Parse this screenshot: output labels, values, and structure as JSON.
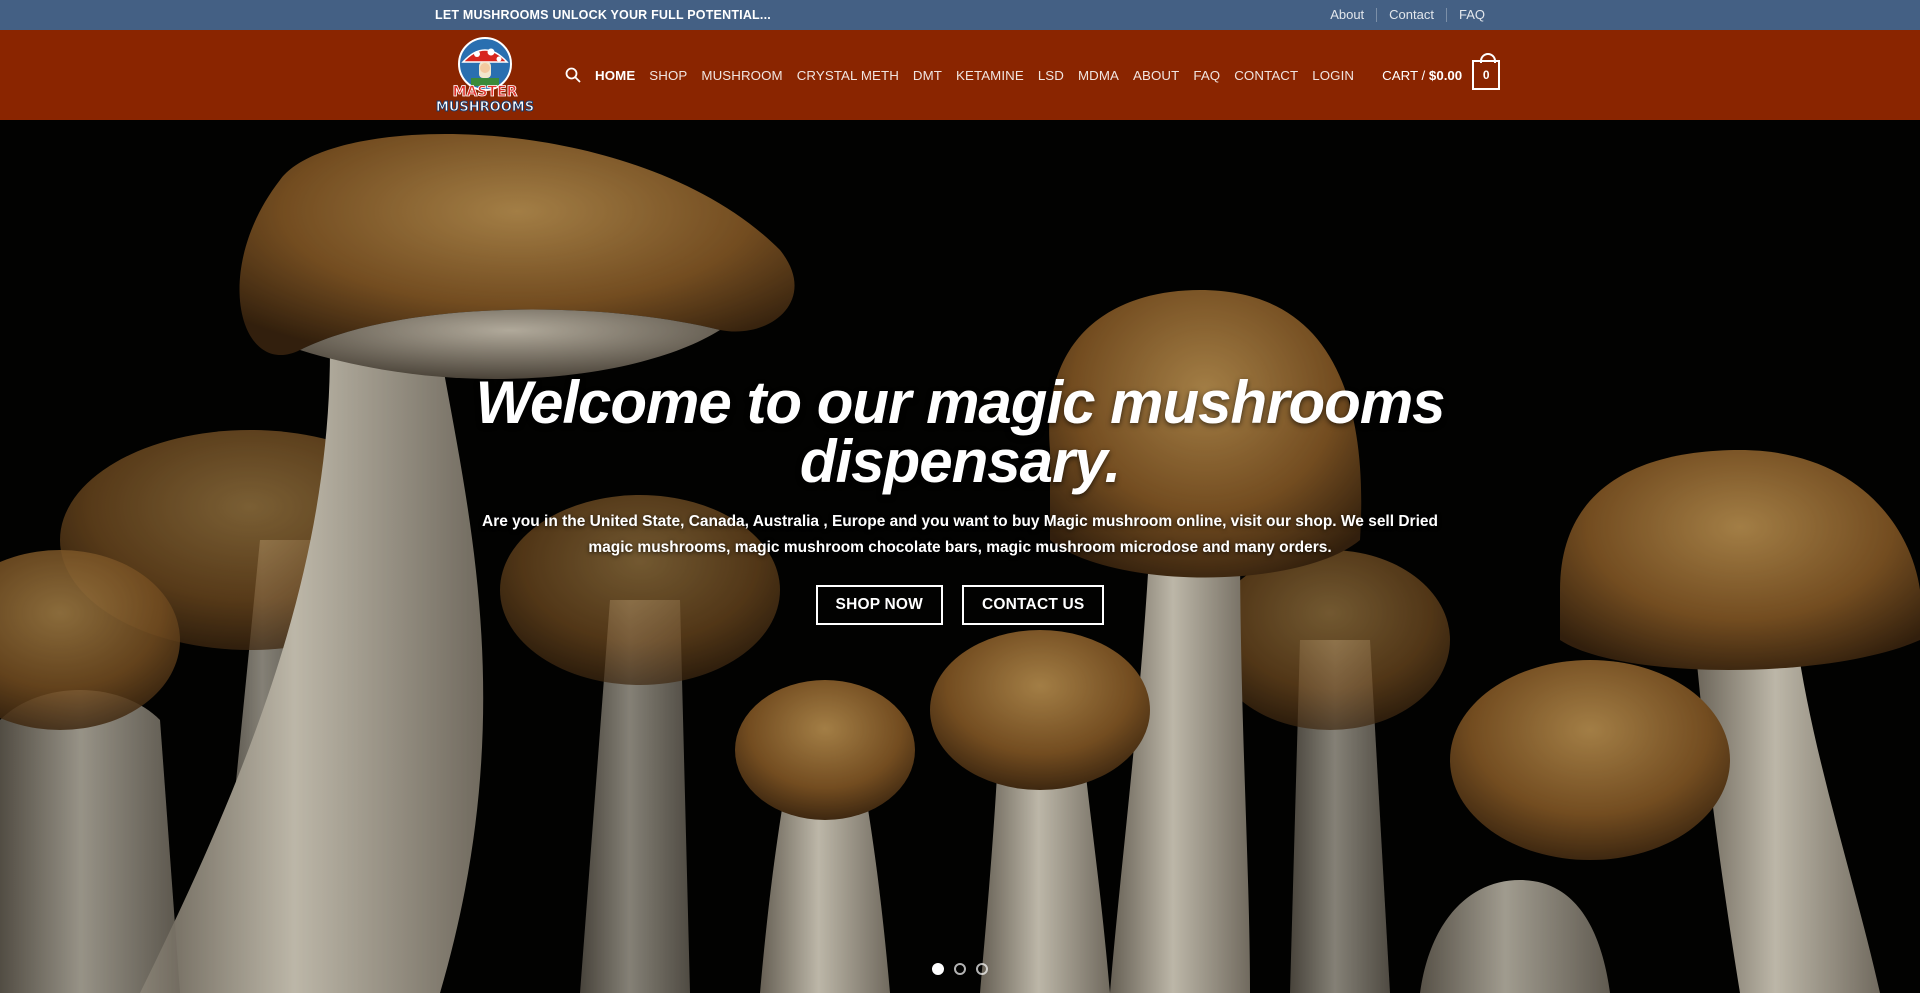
{
  "topbar": {
    "tagline": "LET MUSHROOMS UNLOCK YOUR FULL POTENTIAL...",
    "links": [
      "About",
      "Contact",
      "FAQ"
    ]
  },
  "header": {
    "logo": {
      "line1": "MASTER",
      "line2": "MUSHROOMS"
    },
    "search_icon": "search-icon",
    "nav": [
      "HOME",
      "SHOP",
      "MUSHROOM",
      "CRYSTAL METH",
      "DMT",
      "KETAMINE",
      "LSD",
      "MDMA",
      "ABOUT",
      "FAQ",
      "CONTACT",
      "LOGIN"
    ],
    "active_nav": "HOME",
    "cart": {
      "label": "CART / ",
      "amount": "$0.00",
      "count": "0",
      "icon": "shopping-bag-icon"
    }
  },
  "hero": {
    "title": "Welcome to our magic mushrooms dispensary.",
    "text": "Are you in the United State, Canada, Australia , Europe  and you want to buy Magic mushroom online, visit our shop. We sell Dried magic mushrooms, magic mushroom chocolate bars, magic mushroom microdose and many orders.",
    "buttons": {
      "shop": "SHOP NOW",
      "contact": "CONTACT US"
    },
    "slides_total": 3,
    "slide_active": 1
  },
  "colors": {
    "topbar": "#446084",
    "header": "#8a2500",
    "hero_bg": "#030302",
    "mushroom_cap": "#9a6a2e",
    "mushroom_stem": "#d9d2c0"
  }
}
